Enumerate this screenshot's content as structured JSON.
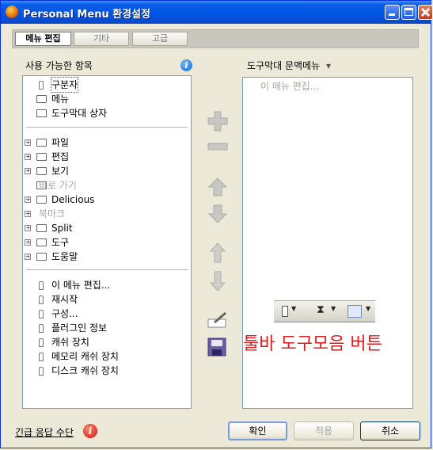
{
  "window": {
    "title": "Personal Menu 환경설정"
  },
  "tabs": [
    "메뉴 편집",
    "기타",
    "고급"
  ],
  "left_panel": {
    "heading": "사용 가능한 항목",
    "info_icon": "i",
    "group1": [
      "구분자",
      "메뉴",
      "도구막대 상자"
    ],
    "group2": [
      {
        "label": "파일",
        "disabled": false
      },
      {
        "label": "편집",
        "disabled": false
      },
      {
        "label": "보기",
        "disabled": false
      },
      {
        "label": "바로 가기",
        "disabled": true
      },
      {
        "label": "Delicious",
        "disabled": false
      },
      {
        "label": "북마크",
        "disabled": true
      },
      {
        "label": "Split",
        "disabled": false
      },
      {
        "label": "도구",
        "disabled": false
      },
      {
        "label": "도움말",
        "disabled": false
      }
    ],
    "group3": [
      "이 메뉴 편집...",
      "재시작",
      "구성...",
      "플러그인 정보",
      "캐쉬 장치",
      "메모리 캐쉬 장치",
      "디스크 캐쉬 장치"
    ]
  },
  "right_panel": {
    "heading": "도구막대 문맥메뉴",
    "dropdown_arrow": "▾",
    "placeholder_item": "이 메뉴 편집..."
  },
  "caption": "툴바 도구모음 버튼",
  "footer": {
    "emergency_label": "긴급 응답 수단",
    "help_icon": "i",
    "ok": "확인",
    "apply": "적용",
    "cancel": "취소"
  },
  "colors": {
    "title_bar": "#0054e3",
    "caption_red": "#e21a1a",
    "panel_border": "#7f9db9"
  }
}
